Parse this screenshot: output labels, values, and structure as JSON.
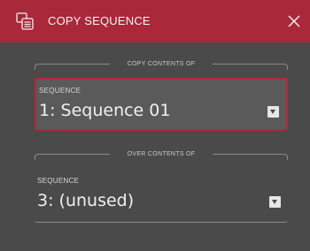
{
  "dialog": {
    "title": "COPY SEQUENCE",
    "icon": "copy-sequence-icon",
    "close_icon": "close-icon",
    "accent_color": "#a9283a"
  },
  "source": {
    "section_label": "COPY CONTENTS OF",
    "field_label": "SEQUENCE",
    "value": "1: Sequence 01"
  },
  "destination": {
    "section_label": "OVER CONTENTS OF",
    "field_label": "SEQUENCE",
    "value": "3: (unused)"
  }
}
